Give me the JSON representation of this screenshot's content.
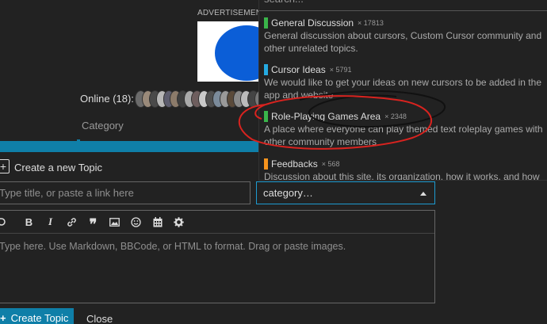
{
  "advertisement": {
    "label": "ADVERTISEMENT"
  },
  "online": {
    "label": "Online (18):",
    "avatar_colors": [
      "#6b6b6b",
      "#9a8a7a",
      "#4a4a4a",
      "#b7b7b7",
      "#5d5d6e",
      "#8c7b6a",
      "#3f3f3f",
      "#aaaaaa",
      "#6e5e5e",
      "#c9c9c9",
      "#505050",
      "#7b8b9b",
      "#999999",
      "#5a4a3a",
      "#888888",
      "#bbbbbb",
      "#444444",
      "#777777"
    ]
  },
  "category_column": {
    "label": "Category"
  },
  "composer": {
    "header": "Create a new Topic",
    "title_placeholder": "Type title, or paste a link here",
    "category_value": "category…",
    "editor_placeholder": "Type here. Use Markdown, BBCode, or HTML to format. Drag or paste images.",
    "create_button": "Create Topic",
    "close_link": "Close",
    "toolbar": [
      "undo-icon",
      "bold-icon",
      "italic-icon",
      "link-icon",
      "quote-icon",
      "image-icon",
      "emoji-icon",
      "calendar-icon",
      "gear-icon"
    ]
  },
  "category_dropdown": {
    "search_placeholder": "search...",
    "items": [
      {
        "name": "General Discussion",
        "count": "× 17813",
        "color": "#3ab54a",
        "description": "General discussion about cursors, Custom Cursor community and other unrelated topics."
      },
      {
        "name": "Cursor Ideas",
        "count": "× 5791",
        "color": "#25aae1",
        "description": "We would like to get your ideas on new cursors to be added in the app and website"
      },
      {
        "name": "Role-Playing Games Area",
        "count": "× 2348",
        "color": "#3ab54a",
        "description": "A place where everyone can play themed text roleplay games with other community members"
      },
      {
        "name": "Feedbacks",
        "count": "× 568",
        "color": "#f7941d",
        "description": "Discussion about this site, its organization, how it works, and how we"
      }
    ]
  },
  "colors": {
    "accent": "#0f7fa8",
    "background": "#222222",
    "annotation_red": "#d9231f"
  }
}
